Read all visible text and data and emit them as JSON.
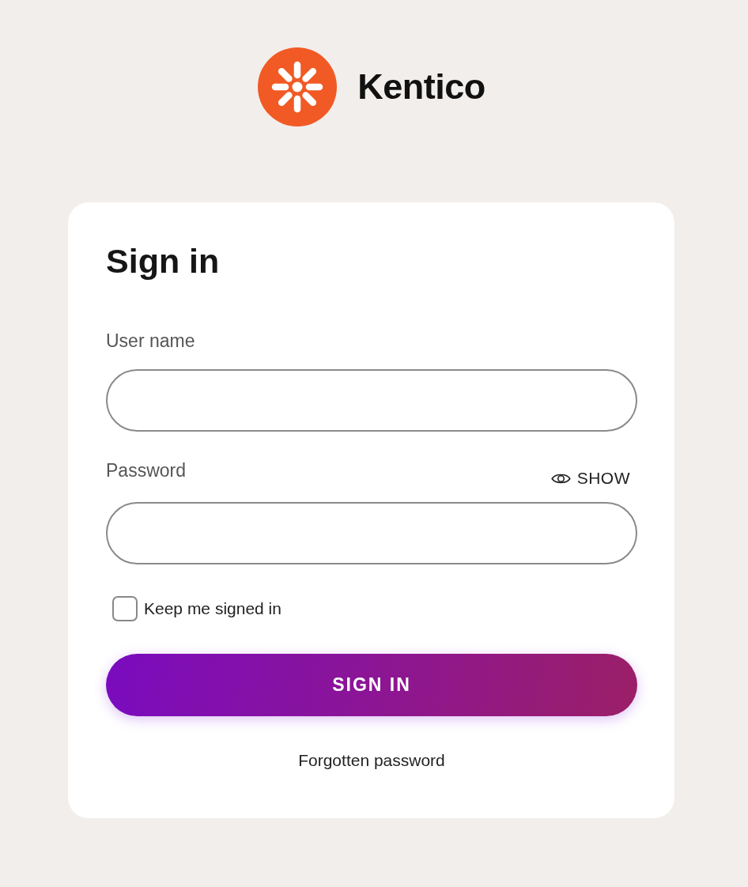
{
  "logo": {
    "name": "Kentico"
  },
  "form": {
    "title": "Sign in",
    "fields": [
      {
        "label": "User name"
      },
      {
        "label": "Password",
        "toggle": "SHOW"
      }
    ],
    "keep_signed_in": {
      "label": "Keep me signed in",
      "checked": false
    },
    "submit": "SIGN IN",
    "forgot_link": "Forgotten password"
  }
}
